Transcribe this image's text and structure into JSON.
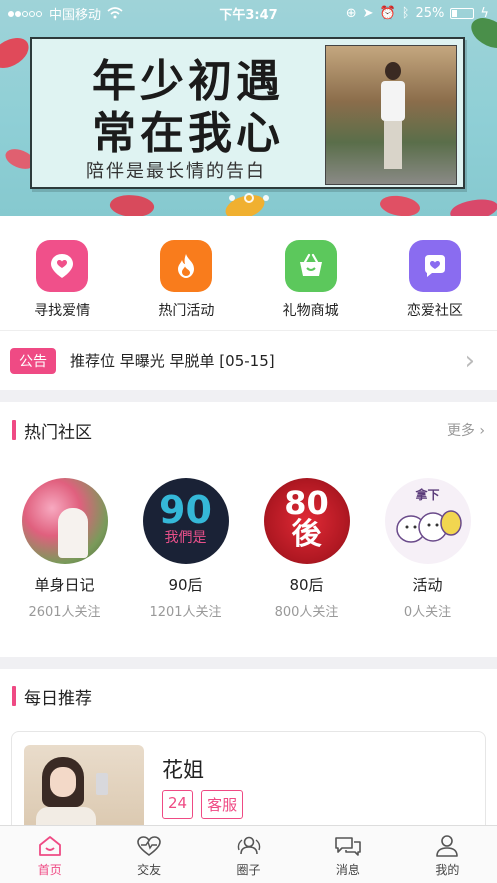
{
  "status_bar": {
    "carrier": "中国移动",
    "time": "下午3:47",
    "battery": "25%",
    "battery_level": 0.25
  },
  "banner": {
    "title_line1": "年少初遇",
    "title_line2": "常在我心",
    "subtitle": "陪伴是最长情的告白",
    "page_count": 3,
    "current_page": 2
  },
  "quick_menu": [
    {
      "label": "寻找爱情",
      "icon": "heart-pin-icon",
      "color": "#f0508a"
    },
    {
      "label": "热门活动",
      "icon": "flame-icon",
      "color": "#f97c1c"
    },
    {
      "label": "礼物商城",
      "icon": "basket-icon",
      "color": "#5cc85c"
    },
    {
      "label": "恋爱社区",
      "icon": "heart-bubble-icon",
      "color": "#8a6cf0"
    }
  ],
  "notice": {
    "tag": "公告",
    "text": "推荐位 早曝光 早脱单 [05-15]"
  },
  "hot_community": {
    "title": "热门社区",
    "more": "更多 ›",
    "items": [
      {
        "name": "单身日记",
        "followers": "2601人关注"
      },
      {
        "name": "90后",
        "followers": "1201人关注",
        "badge_big": "90",
        "badge_small": "我們是"
      },
      {
        "name": "80后",
        "followers": "800人关注",
        "badge_big": "80",
        "badge_small": "後"
      },
      {
        "name": "活动",
        "followers": "0人关注",
        "badge_small": "拿下"
      }
    ]
  },
  "daily": {
    "title": "每日推荐",
    "card": {
      "name": "花姐",
      "tags": [
        "24",
        "客服"
      ]
    }
  },
  "tabbar": [
    {
      "label": "首页",
      "icon": "home-icon",
      "active": true
    },
    {
      "label": "交友",
      "icon": "heart-pulse-icon",
      "active": false
    },
    {
      "label": "圈子",
      "icon": "circle-people-icon",
      "active": false
    },
    {
      "label": "消息",
      "icon": "chat-bubbles-icon",
      "active": false
    },
    {
      "label": "我的",
      "icon": "user-icon",
      "active": false
    }
  ],
  "colors": {
    "accent": "#ef4a84"
  }
}
